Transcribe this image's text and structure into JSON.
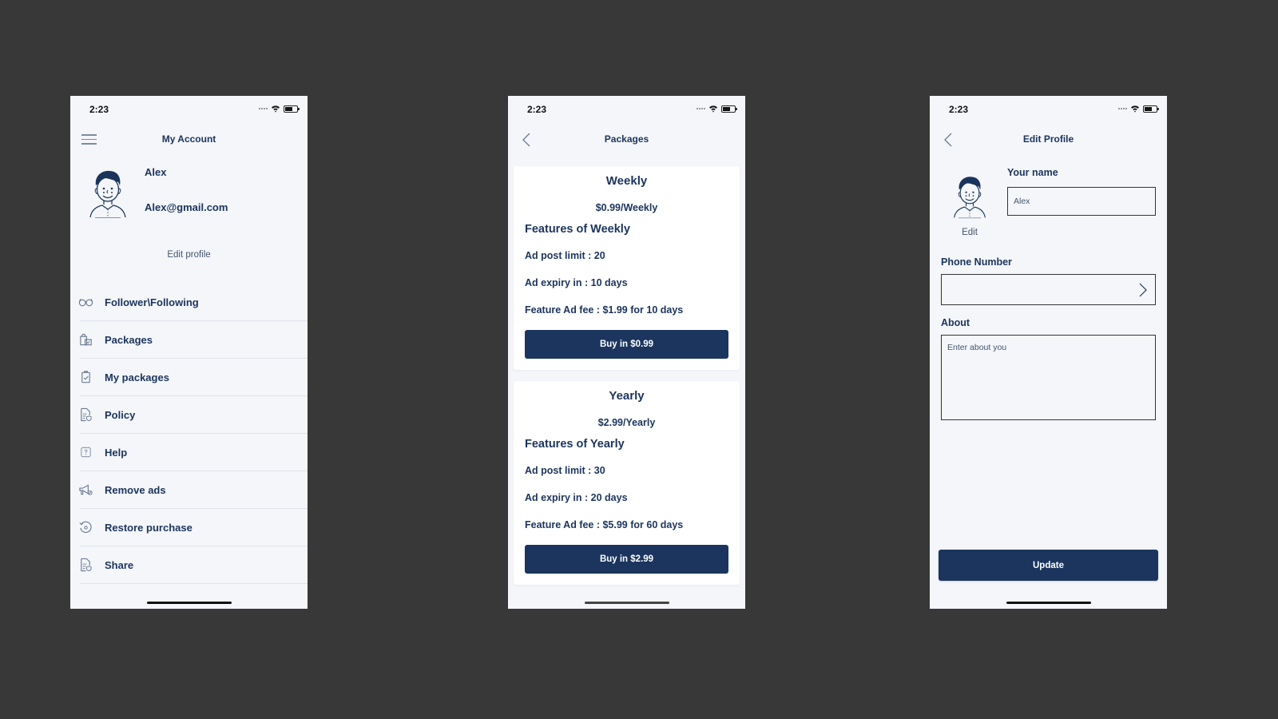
{
  "status_bar": {
    "time": "2:23"
  },
  "colors": {
    "primary": "#1b355e",
    "screen_bg": "#f4f6fa",
    "canvas_bg": "#383838",
    "text": "#1b345c"
  },
  "my_account": {
    "title": "My Account",
    "menu_icon": "hamburger-icon",
    "user": {
      "name": "Alex",
      "email": "Alex@gmail.com",
      "avatar": "avatar-illustration"
    },
    "edit_profile_label": "Edit profile",
    "menu": [
      {
        "label": "Follower\\Following",
        "icon": "glasses-icon"
      },
      {
        "label": "Packages",
        "icon": "shopping-bags-icon"
      },
      {
        "label": "My packages",
        "icon": "clipboard-check-icon"
      },
      {
        "label": "Policy",
        "icon": "document-shield-icon"
      },
      {
        "label": "Help",
        "icon": "question-box-icon"
      },
      {
        "label": "Remove ads",
        "icon": "megaphone-icon"
      },
      {
        "label": "Restore purchase",
        "icon": "restore-icon"
      },
      {
        "label": "Share",
        "icon": "document-shield-icon"
      }
    ]
  },
  "packages": {
    "title": "Packages",
    "back_icon": "chevron-left-icon",
    "plans": [
      {
        "name": "Weekly",
        "price": "$0.99/Weekly",
        "features_title": "Features of Weekly",
        "features": [
          "Ad post limit : 20",
          "Ad expiry in : 10 days",
          "Feature Ad fee : $1.99 for 10 days"
        ],
        "button": "Buy in $0.99"
      },
      {
        "name": "Yearly",
        "price": "$2.99/Yearly",
        "features_title": "Features of Yearly",
        "features": [
          "Ad post limit : 30",
          "Ad expiry in : 20 days",
          "Feature Ad fee : $5.99 for 60 days"
        ],
        "button": "Buy in $2.99"
      }
    ]
  },
  "edit_profile": {
    "title": "Edit Profile",
    "back_icon": "chevron-left-icon",
    "avatar_edit_label": "Edit",
    "name_label": "Your name",
    "name_value": "Alex",
    "phone_label": "Phone Number",
    "phone_value": "",
    "about_label": "About",
    "about_placeholder": "Enter about you",
    "update_button": "Update"
  }
}
